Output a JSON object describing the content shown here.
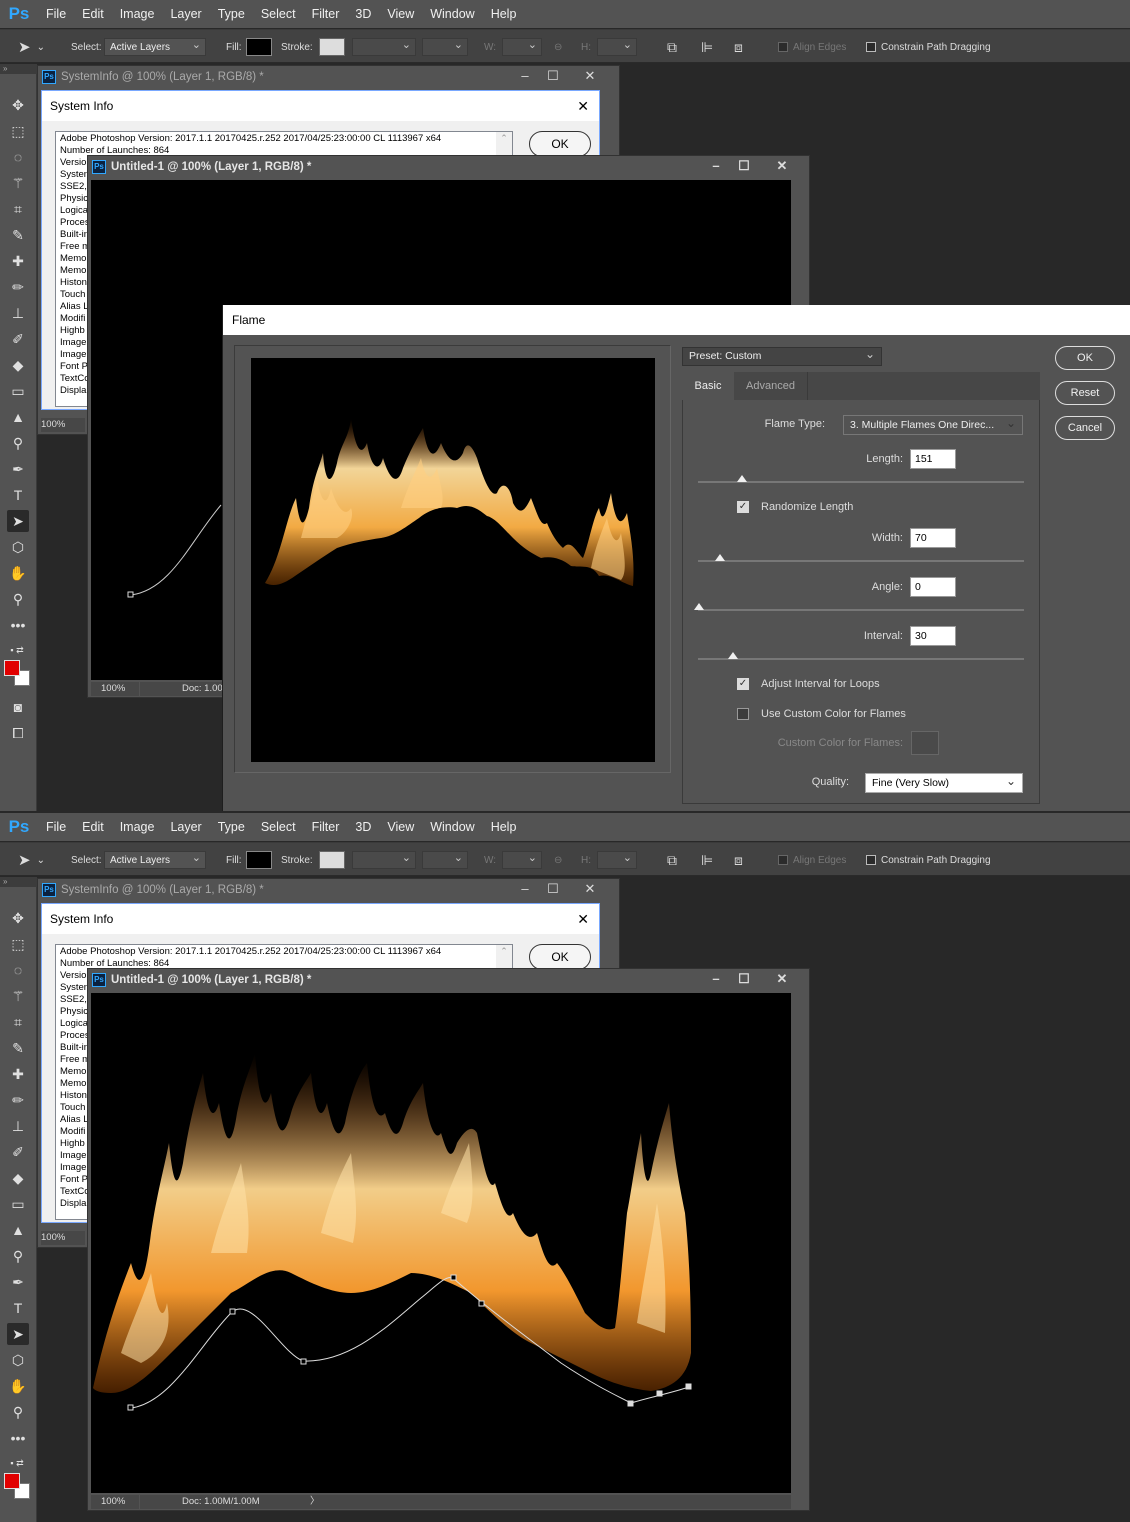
{
  "app": {
    "logo": "Ps",
    "menu": [
      "File",
      "Edit",
      "Image",
      "Layer",
      "Type",
      "Select",
      "Filter",
      "3D",
      "View",
      "Window",
      "Help"
    ]
  },
  "options": {
    "select_label": "Select:",
    "select_value": "Active Layers",
    "fill_label": "Fill:",
    "stroke_label": "Stroke:",
    "w_label": "W:",
    "h_label": "H:",
    "link_glyph": "⊖",
    "align_edges": "Align Edges",
    "constrain": "Constrain Path Dragging"
  },
  "sysinfo": {
    "win_title": "SystemInfo @ 100% (Layer 1, RGB/8) *",
    "dialog_title": "System Info",
    "ok": "OK",
    "zoom": "100%",
    "lines": [
      "Adobe Photoshop Version: 2017.1.1 20170425.r.252 2017/04/25:23:00:00 CL 1113967  x64",
      "Number of Launches: 864",
      "Versio",
      "Systen",
      "SSE2,",
      "Physic",
      "Logica",
      "Proces",
      "Built-in",
      "Free m",
      "Memo",
      "Memo",
      "Histon",
      "Touch",
      "Alias L",
      "Modifi",
      "Highb",
      "Image",
      "Image",
      "Font P",
      "TextCo",
      "Displa"
    ]
  },
  "doc": {
    "win_title": "Untitled-1 @ 100% (Layer 1, RGB/8) *",
    "zoom": "100%",
    "doc_size_short": "Doc: 1.00",
    "doc_size": "Doc: 1.00M/1.00M",
    "arrow": "〉"
  },
  "flame": {
    "title": "Flame",
    "preset": "Preset: Custom",
    "tab_basic": "Basic",
    "tab_advanced": "Advanced",
    "flame_type_label": "Flame Type:",
    "flame_type_value": "3. Multiple Flames One Direc...",
    "length_label": "Length:",
    "length_value": "151",
    "randomize_length": "Randomize Length",
    "width_label": "Width:",
    "width_value": "70",
    "angle_label": "Angle:",
    "angle_value": "0",
    "interval_label": "Interval:",
    "interval_value": "30",
    "adjust_interval": "Adjust Interval for Loops",
    "use_custom_color": "Use Custom Color for Flames",
    "custom_color_label": "Custom Color for Flames:",
    "quality_label": "Quality:",
    "quality_value": "Fine (Very Slow)",
    "ok": "OK",
    "reset": "Reset",
    "cancel": "Cancel",
    "randomize_checked": true,
    "adjust_checked": true,
    "custom_checked": false
  },
  "colors": {
    "foreground": "#e10000",
    "background": "#ffffff",
    "ps_blue": "#31a8ff"
  },
  "tools": [
    "move-icon",
    "marquee-icon",
    "lasso-icon",
    "magic-wand-icon",
    "crop-icon",
    "eyedropper-icon",
    "healing-icon",
    "brush-icon",
    "stamp-icon",
    "history-brush-icon",
    "eraser-icon",
    "gradient-icon",
    "blur-icon",
    "dodge-icon",
    "pen-icon",
    "type-icon",
    "path-select-icon",
    "shape-icon",
    "hand-icon",
    "zoom-icon",
    "more-icon"
  ]
}
